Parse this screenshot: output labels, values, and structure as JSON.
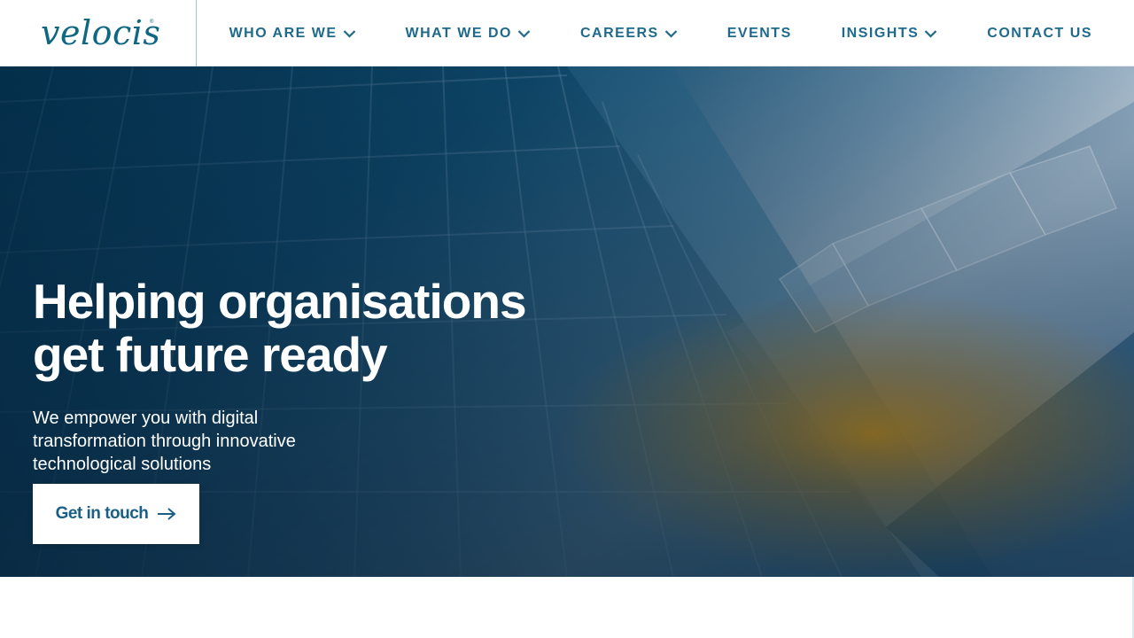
{
  "brand": {
    "logo_text": "velocis",
    "trademark": "®",
    "color": "#0e6783"
  },
  "nav": {
    "items": [
      {
        "label": "WHO ARE WE",
        "has_dropdown": true
      },
      {
        "label": "WHAT WE DO",
        "has_dropdown": true
      },
      {
        "label": "CAREERS",
        "has_dropdown": true
      },
      {
        "label": "EVENTS",
        "has_dropdown": false
      },
      {
        "label": "INSIGHTS",
        "has_dropdown": true
      },
      {
        "label": "CONTACT US",
        "has_dropdown": false
      }
    ],
    "color": "#1f6a8c"
  },
  "hero": {
    "title_line1": "Helping organisations",
    "title_line2": "get future ready",
    "subtitle": "We empower you with digital transformation through innovative technological solutions",
    "cta_label": "Get in touch",
    "cta_icon": "arrow-right-icon",
    "background": "glass-building-photo"
  }
}
